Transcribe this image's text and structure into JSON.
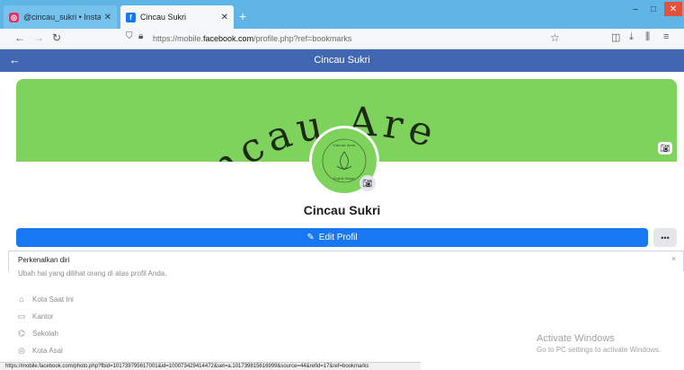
{
  "browser": {
    "tabs": [
      {
        "title": "@cincau_sukri • Instagram pho",
        "close": "✕",
        "favicon": "instagram-icon"
      },
      {
        "title": "Cincau Sukri",
        "close": "✕",
        "favicon": "facebook-icon"
      }
    ],
    "new_tab": "+",
    "window_controls": {
      "minimize": "–",
      "maximize": "□",
      "close": "✕"
    },
    "url_prefix": "https://mobile.",
    "url_host": "facebook.com",
    "url_suffix": "/profile.php?ref=bookmarks"
  },
  "header": {
    "back": "←",
    "title": "Cincau Sukri"
  },
  "cover": {
    "arc_text": "incau Are",
    "logo_text_top": "Cincau Area",
    "logo_text_bottom": "Sejuk Segar",
    "color": "#7ed35c"
  },
  "profile": {
    "name": "Cincau Sukri",
    "edit_label": "Edit Profil",
    "more_label": "•••"
  },
  "intro": {
    "title": "Perkenalkan diri",
    "subtitle": "Ubah hal yang dilihat orang di atas profil Anda.",
    "close": "×",
    "rows": [
      {
        "label": "Kota Saat Ini",
        "icon": "location-icon"
      },
      {
        "label": "Kantor",
        "icon": "briefcase-icon"
      },
      {
        "label": "Sekolah",
        "icon": "school-icon"
      },
      {
        "label": "Kota Asal",
        "icon": "pin-icon"
      }
    ]
  },
  "watermark": {
    "line1": "Activate Windows",
    "line2": "Go to PC settings to activate Windows."
  },
  "status_url": "https://mobile.facebook.com/photo.php?fbid=101739795617001&id=100073429414472&set=a.101739815616999&source=44&refid=17&ref=bookmarks",
  "colors": {
    "fb_blue": "#4267b2",
    "button_blue": "#1877f2",
    "cover_green": "#7ed35c"
  }
}
